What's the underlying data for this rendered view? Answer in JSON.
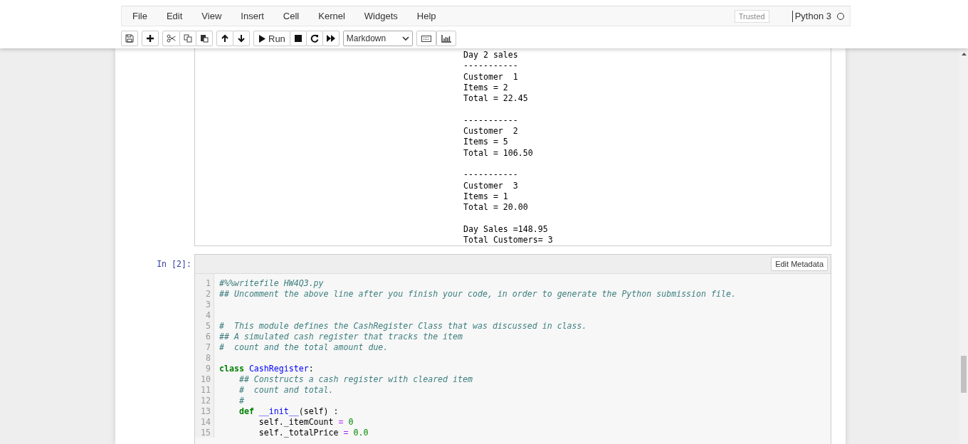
{
  "menu": [
    "File",
    "Edit",
    "View",
    "Insert",
    "Cell",
    "Kernel",
    "Widgets",
    "Help"
  ],
  "trusted": "Trusted",
  "kernel": {
    "name": "Python 3",
    "busy": false
  },
  "toolbar": {
    "run_label": "Run",
    "cell_type": "Markdown"
  },
  "output": "Day 2 sales\n-----------\nCustomer  1\nItems = 2\nTotal = 22.45\n\n-----------\nCustomer  2\nItems = 5\nTotal = 106.50\n\n-----------\nCustomer  3\nItems = 1\nTotal = 20.00\n\nDay Sales =148.95\nTotal Customers= 3",
  "cell": {
    "prompt": "In [2]:",
    "toolbar_button": "Edit Metadata",
    "lines": [
      {
        "number": "1",
        "tokens": [
          {
            "kind": "comment",
            "text": "#%%writefile HW4Q3.py"
          }
        ]
      },
      {
        "number": "2",
        "tokens": [
          {
            "kind": "comment",
            "text": "## Uncomment the above line after you finish your code, in order to generate the Python submission file."
          }
        ]
      },
      {
        "number": "3"
      },
      {
        "number": "4"
      },
      {
        "number": "5",
        "tokens": [
          {
            "kind": "comment",
            "text": "#  This module defines the CashRegister Class that was discussed in class."
          }
        ]
      },
      {
        "number": "6",
        "tokens": [
          {
            "kind": "comment",
            "text": "## A simulated cash register that tracks the item"
          }
        ]
      },
      {
        "number": "7",
        "tokens": [
          {
            "kind": "comment",
            "text": "#  count and the total amount due."
          }
        ]
      },
      {
        "number": "8"
      },
      {
        "number": "9",
        "tokens": [
          {
            "kind": "keyword",
            "text": "class"
          },
          {
            "kind": "name",
            "text": " CashRegister"
          },
          {
            "kind": "plain",
            "text": ":"
          }
        ]
      },
      {
        "number": "10",
        "tokens": [
          {
            "kind": "comment",
            "text": "    ## Constructs a cash register with cleared item"
          }
        ]
      },
      {
        "number": "11",
        "tokens": [
          {
            "kind": "comment",
            "text": "    #  count and total."
          }
        ]
      },
      {
        "number": "12",
        "tokens": [
          {
            "kind": "comment",
            "text": "    #"
          }
        ]
      },
      {
        "number": "13",
        "tokens": [
          {
            "kind": "keyword",
            "text": "    def"
          },
          {
            "kind": "name",
            "text": " __init__"
          },
          {
            "kind": "plain",
            "text": "(self) :"
          }
        ]
      },
      {
        "number": "14",
        "tokens": [
          {
            "kind": "plain",
            "text": "        self._itemCount "
          },
          {
            "kind": "operator",
            "text": "="
          },
          {
            "kind": "number",
            "text": " 0"
          }
        ]
      },
      {
        "number": "15",
        "tokens": [
          {
            "kind": "plain",
            "text": "        self._totalPrice "
          },
          {
            "kind": "operator",
            "text": "="
          },
          {
            "kind": "number",
            "text": " 0.0"
          }
        ]
      }
    ]
  }
}
